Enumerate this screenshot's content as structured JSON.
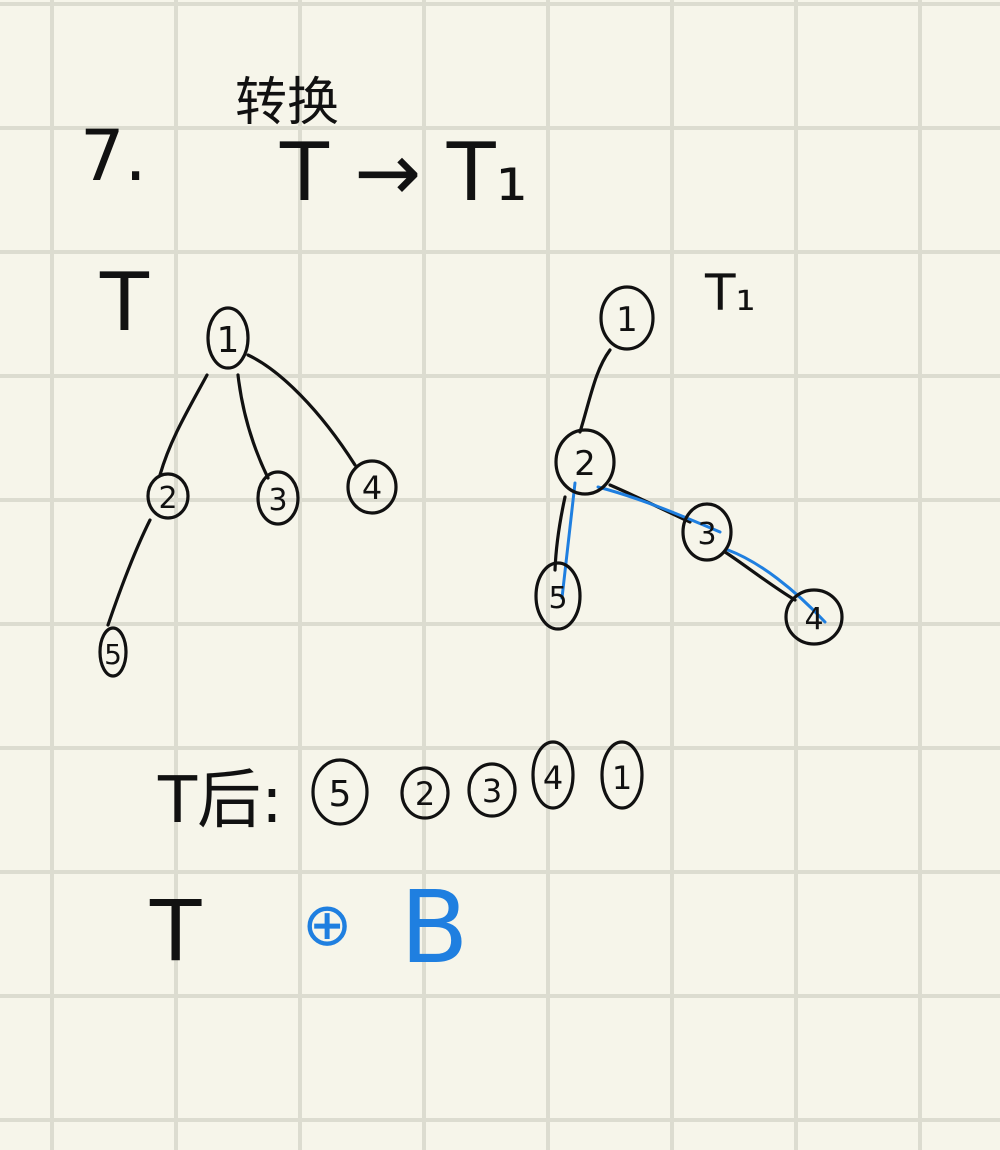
{
  "problem_number": "7.",
  "heading_top": "转换",
  "heading_mid": "T → T₁",
  "tree_T": {
    "label": "T",
    "nodes": [
      "1",
      "2",
      "3",
      "4",
      "5"
    ],
    "edges": [
      [
        "1",
        "2"
      ],
      [
        "1",
        "3"
      ],
      [
        "1",
        "4"
      ],
      [
        "2",
        "5"
      ]
    ]
  },
  "tree_T1": {
    "label": "T₁",
    "nodes": [
      "1",
      "2",
      "5",
      "3",
      "4"
    ],
    "edges": [
      [
        "1",
        "2"
      ],
      [
        "2",
        "5"
      ],
      [
        "2",
        "3"
      ],
      [
        "3",
        "4"
      ]
    ]
  },
  "traversal_label": "T后:",
  "traversal_sequence": [
    "5",
    "2",
    "3",
    "4",
    "1"
  ],
  "answer_label": "T",
  "answer_symbol": "⊕",
  "answer_value": "B",
  "colors": {
    "ink": "#111111",
    "blue": "#1f7fe0",
    "paper": "#f6f5ea",
    "grid": "#dcdcd0"
  }
}
